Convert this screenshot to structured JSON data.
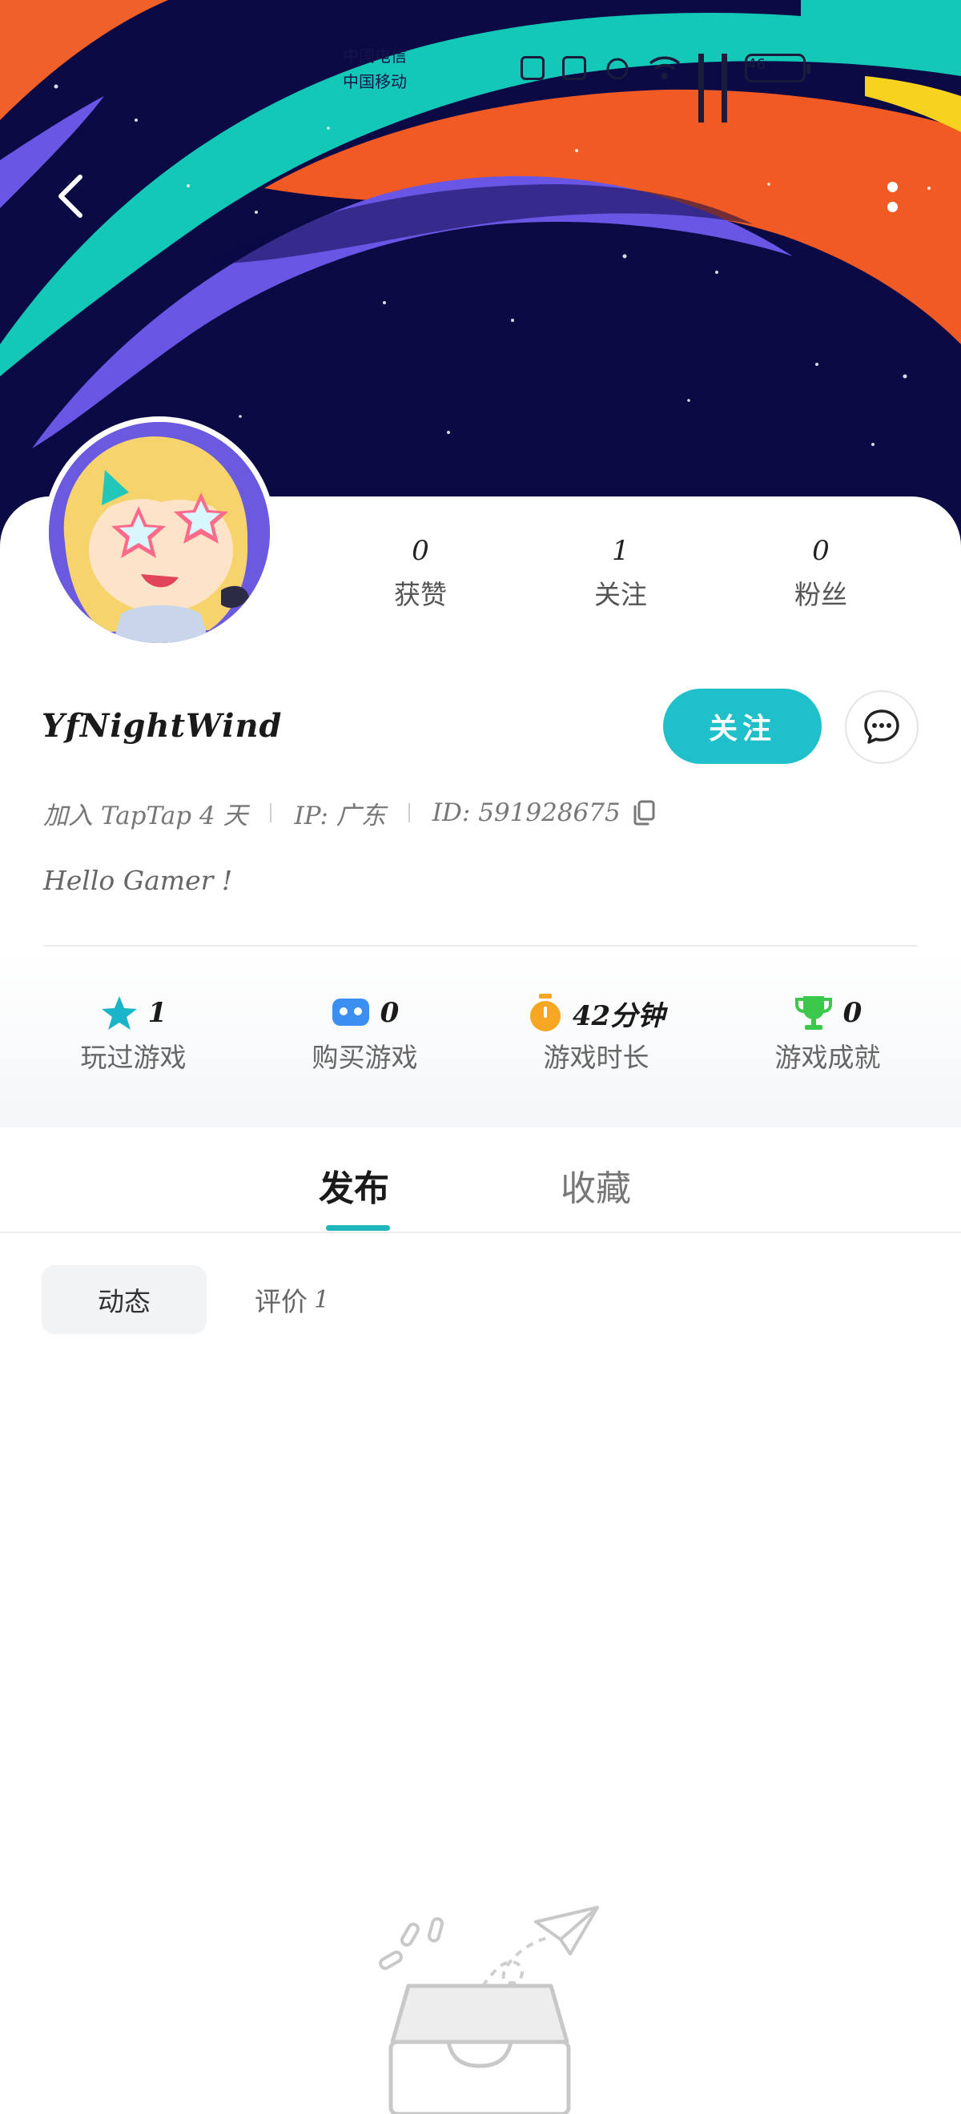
{
  "status_bar": {
    "carrier_1": "中国电信",
    "carrier_2": "中国移动",
    "battery": "46"
  },
  "profile": {
    "stats": [
      {
        "value": "0",
        "label": "获赞"
      },
      {
        "value": "1",
        "label": "关注"
      },
      {
        "value": "0",
        "label": "粉丝"
      }
    ],
    "username": "YfNightWind",
    "follow_label": "关注",
    "meta": {
      "joined": "加入 TapTap 4 天",
      "ip": "IP: 广东",
      "id": "ID: 591928675"
    },
    "bio": "Hello Gamer !"
  },
  "games": [
    {
      "icon": "star-icon",
      "value": "1",
      "label": "玩过游戏",
      "color": "#1ab5c8"
    },
    {
      "icon": "gamepad-icon",
      "value": "0",
      "label": "购买游戏",
      "color": "#3a8ff0"
    },
    {
      "icon": "timer-icon",
      "value": "42分钟",
      "label": "游戏时长",
      "color": "#f5a623"
    },
    {
      "icon": "trophy-icon",
      "value": "0",
      "label": "游戏成就",
      "color": "#3cc84a"
    }
  ],
  "tabs": {
    "publish": "发布",
    "favorites": "收藏"
  },
  "subtabs": {
    "moments": "动态",
    "reviews": "评价",
    "reviews_count": "1"
  },
  "colors": {
    "accent": "#1fc0c9",
    "banner_bg": "#0b0a45"
  }
}
